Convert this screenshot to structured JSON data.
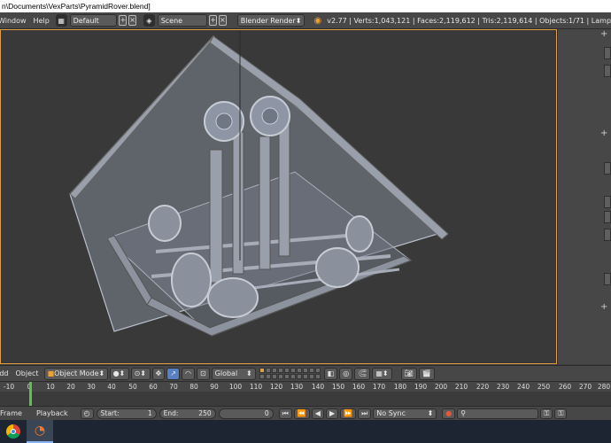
{
  "title_bar": {
    "text": "n\\Documents\\VexParts\\PyramidRover.blend]"
  },
  "info_header": {
    "menus": [
      "Window",
      "Help"
    ],
    "screen_layout": "Default",
    "scene": "Scene",
    "render_engine": "Blender Render",
    "stats": "v2.77 | Verts:1,043,121 | Faces:2,119,612 | Tris:2,119,614 | Objects:1/71 | Lamp"
  },
  "view3d_header": {
    "menus": [
      "Add",
      "Object"
    ],
    "mode": "Object Mode",
    "transform_orientation": "Global"
  },
  "timeline": {
    "ticks": [
      "-10",
      "0",
      "10",
      "20",
      "30",
      "40",
      "50",
      "60",
      "70",
      "80",
      "90",
      "100",
      "110",
      "120",
      "130",
      "140",
      "150",
      "160",
      "170",
      "180",
      "190",
      "200",
      "210",
      "220",
      "230",
      "240",
      "250",
      "260",
      "270",
      "280"
    ],
    "current_frame_marker": 1
  },
  "timeline_header": {
    "menus": [
      "Frame",
      "Playback"
    ],
    "start_label": "Start:",
    "start_value": "1",
    "end_label": "End:",
    "end_value": "250",
    "current_frame": "0",
    "sync": "No Sync"
  },
  "colors": {
    "viewport_border": "#e0a040",
    "frame_indicator": "#5ac34c",
    "active_button": "#5680c2"
  },
  "taskbar": {
    "icons": [
      "chrome-icon",
      "blender-icon"
    ]
  }
}
